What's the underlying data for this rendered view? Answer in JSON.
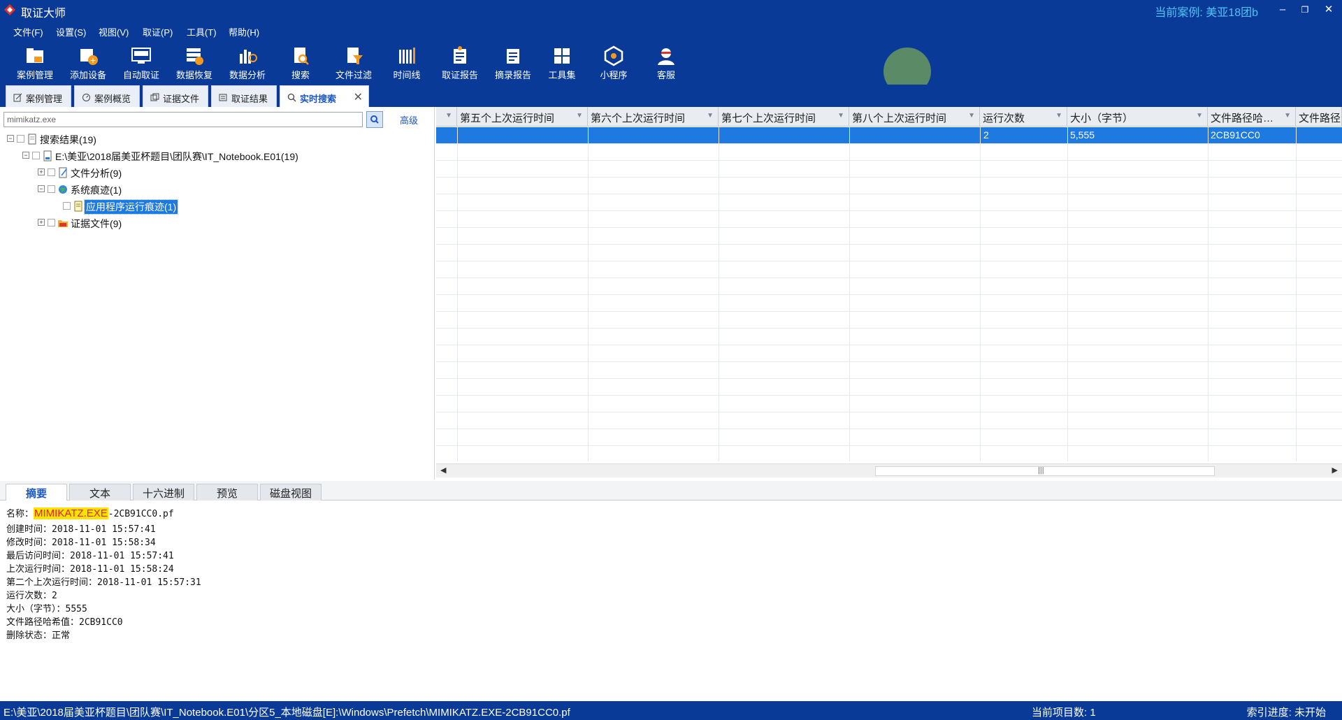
{
  "app": {
    "title": "取证大师",
    "current_case": "当前案例: 美亚18团b",
    "minimize": "–",
    "restore": "❐",
    "close": "✕"
  },
  "menu": [
    "文件(F)",
    "设置(S)",
    "视图(V)",
    "取证(P)",
    "工具(T)",
    "帮助(H)"
  ],
  "toolbar": [
    {
      "label": "案例管理",
      "icon": "case-management-icon"
    },
    {
      "label": "添加设备",
      "icon": "add-device-icon"
    },
    {
      "label": "自动取证",
      "icon": "auto-forensics-icon"
    },
    {
      "label": "数据恢复",
      "icon": "data-recovery-icon"
    },
    {
      "label": "数据分析",
      "icon": "data-analysis-icon"
    },
    {
      "label": "搜索",
      "icon": "search-icon"
    },
    {
      "label": "文件过滤",
      "icon": "file-filter-icon"
    },
    {
      "label": "时间线",
      "icon": "timeline-icon"
    },
    {
      "label": "取证报告",
      "icon": "forensics-report-icon"
    },
    {
      "label": "摘录报告",
      "icon": "excerpt-report-icon"
    },
    {
      "label": "工具集",
      "icon": "toolset-icon"
    },
    {
      "label": "小程序",
      "icon": "mini-program-icon"
    },
    {
      "label": "客服",
      "icon": "customer-service-icon"
    }
  ],
  "doc_tabs": [
    {
      "label": "案例管理"
    },
    {
      "label": "案例概览"
    },
    {
      "label": "证据文件"
    },
    {
      "label": "取证结果"
    },
    {
      "label": "实时搜索",
      "active": true,
      "close": "✕"
    }
  ],
  "search": {
    "value": "mimikatz.exe",
    "advanced": "高级"
  },
  "tree": [
    {
      "label": "搜索结果(19)",
      "expander": "−"
    },
    {
      "label": "E:\\美亚\\2018届美亚杯题目\\团队赛\\IT_Notebook.E01(19)",
      "expander": "−"
    },
    {
      "label": "文件分析(9)",
      "expander": "+"
    },
    {
      "label": "系统痕迹(1)",
      "expander": "−"
    },
    {
      "label": "应用程序运行痕迹(1)",
      "selected": true
    },
    {
      "label": "证据文件(9)",
      "expander": "+"
    }
  ],
  "grid": {
    "columns": [
      "",
      "第五个上次运行时间",
      "第六个上次运行时间",
      "第七个上次运行时间",
      "第八个上次运行时间",
      "运行次数",
      "大小（字节）",
      "文件路径哈…",
      "文件路径"
    ],
    "filter_glyph": "▼",
    "selected_row": [
      "",
      "",
      "",
      "",
      "",
      "2",
      "5,555",
      "2CB91CC0",
      ""
    ],
    "scroll_left": "◀",
    "scroll_right": "▶",
    "scroll_grip": "|||"
  },
  "bottom_tabs": [
    "摘要",
    "文本",
    "十六进制",
    "预览",
    "磁盘视图"
  ],
  "summary": {
    "name_label": "名称：",
    "name_highlight": "MIMIKATZ.EXE",
    "name_rest": "-2CB91CC0.pf",
    "lines": [
      "创建时间：2018-11-01 15:57:41",
      "修改时间：2018-11-01 15:58:34",
      "最后访问时间：2018-11-01 15:57:41",
      "上次运行时间：2018-11-01 15:58:24",
      "第二个上次运行时间：2018-11-01 15:57:31",
      "运行次数：2",
      "大小（字节）：5555",
      "文件路径哈希值：2CB91CC0",
      "删除状态：正常"
    ]
  },
  "status": {
    "path": "E:\\美亚\\2018届美亚杯题目\\团队赛\\IT_Notebook.E01\\分区5_本地磁盘[E]:\\Windows\\Prefetch\\MIMIKATZ.EXE-2CB91CC0.pf",
    "count": "当前项目数: 1",
    "index": "索引进度: 未开始"
  },
  "colors": {
    "chrome": "#0a3a97",
    "selection": "#1e7ae0",
    "highlight": "#ffe400",
    "highlight_text": "#e0201f",
    "case_text": "#4fc3f7"
  }
}
